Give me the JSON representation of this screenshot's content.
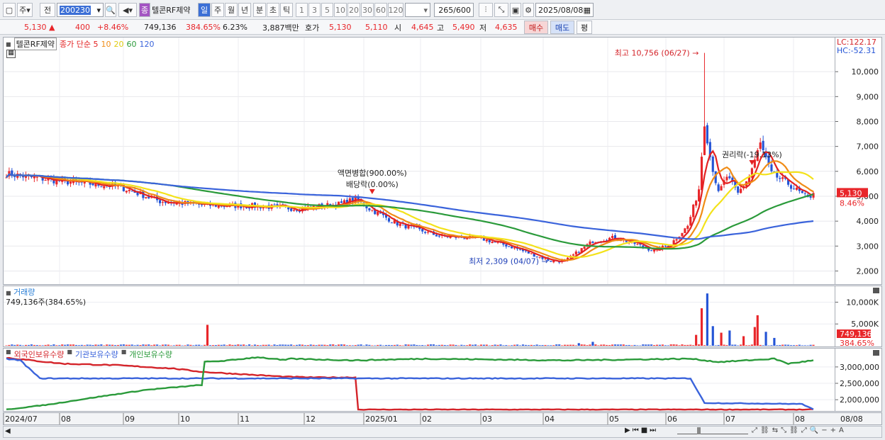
{
  "toolbar": {
    "code": "200230",
    "tab_ju": "주",
    "tab_jeon": "전",
    "badge": "종",
    "stock_name": "텔콘RF제약",
    "periods": [
      "일",
      "주",
      "월",
      "년",
      "분",
      "초",
      "틱"
    ],
    "intervals": [
      "1",
      "3",
      "5",
      "10",
      "20",
      "30",
      "60",
      "120"
    ],
    "count": "265",
    "count_total": "/600",
    "date": "2025/08/08"
  },
  "quote": {
    "price": "5,130",
    "arrow": "▲",
    "change": "400",
    "change_pct": "+8.46%",
    "volume": "749,136",
    "volume_pct": "384.65%",
    "turnover": "6.23%",
    "amount": "3,887백만",
    "hoga_label": "호가",
    "ask": "5,130",
    "bid": "5,110",
    "open_label": "시",
    "open": "4,645",
    "high_label": "고",
    "high": "5,490",
    "low_label": "저",
    "low": "4,635",
    "buy_btn": "매수",
    "sell_btn": "매도",
    "eval_btn": "평"
  },
  "colors": {
    "up": "#e8262a",
    "down": "#2454d6",
    "ma5": "#e32222",
    "ma10": "#f08c16",
    "ma20": "#f3e21a",
    "ma60": "#2a9a3a",
    "ma120": "#3a63db"
  },
  "chart_data": [
    {
      "type": "candlestick",
      "title": "텔콘RF제약",
      "legend": [
        "종가 단순 5",
        "10",
        "20",
        "60",
        "120"
      ],
      "ylim": [
        1700,
        11000
      ],
      "yticks": [
        "2,000",
        "3,000",
        "4,000",
        "5,000",
        "6,000",
        "7,000",
        "8,000",
        "9,000",
        "10,000"
      ],
      "ytick_values": [
        2000,
        3000,
        4000,
        5000,
        6000,
        7000,
        8000,
        9000,
        10000
      ],
      "x_labels": [
        "2024/07",
        "08",
        "09",
        "10",
        "11",
        "12",
        "2025/01",
        "02",
        "03",
        "04",
        "05",
        "06",
        "07",
        "08"
      ],
      "right_labels": {
        "lc": "LC:122.17",
        "hc": "HC:-52.31",
        "last": "5,130",
        "last_pct": "8.46%"
      },
      "annotations": {
        "high": "최고 10,756 (06/27)",
        "low": "최저 2,309 (04/07)",
        "event1": "액면병합(900.00%)",
        "event2": "배당락(0.00%)",
        "event3": "권리락(-19.13%)"
      },
      "high_value": 10756,
      "low_value": 2309,
      "close_approx_anchors": [
        [
          0,
          5900
        ],
        [
          20,
          5600
        ],
        [
          40,
          5400
        ],
        [
          55,
          4800
        ],
        [
          70,
          4650
        ],
        [
          90,
          4600
        ],
        [
          105,
          4500
        ],
        [
          120,
          4700
        ],
        [
          125,
          4900
        ],
        [
          130,
          4500
        ],
        [
          140,
          3900
        ],
        [
          155,
          3400
        ],
        [
          170,
          3300
        ],
        [
          180,
          3000
        ],
        [
          190,
          2600
        ],
        [
          195,
          2400
        ],
        [
          200,
          2400
        ],
        [
          205,
          2800
        ],
        [
          210,
          3200
        ],
        [
          218,
          3350
        ],
        [
          225,
          3100
        ],
        [
          232,
          2800
        ],
        [
          238,
          3100
        ],
        [
          244,
          3800
        ],
        [
          248,
          5300
        ],
        [
          250,
          8000
        ],
        [
          252,
          6600
        ],
        [
          255,
          5100
        ],
        [
          258,
          5800
        ],
        [
          262,
          5100
        ],
        [
          266,
          5800
        ],
        [
          270,
          7100
        ],
        [
          274,
          5900
        ],
        [
          280,
          5500
        ],
        [
          287,
          4900
        ],
        [
          289,
          5130
        ]
      ],
      "ma_series": [
        {
          "name": "5",
          "color": "#e32222"
        },
        {
          "name": "10",
          "color": "#f08c16"
        },
        {
          "name": "20",
          "color": "#f3e21a"
        },
        {
          "name": "60",
          "color": "#2a9a3a"
        },
        {
          "name": "120",
          "color": "#3a63db"
        }
      ]
    },
    {
      "type": "bar",
      "title": "거래량",
      "value_text": "749,136주(384.65%)",
      "yticks": [
        "5,000K",
        "10,000K"
      ],
      "ytick_values": [
        5000,
        10000
      ],
      "last_label": "749,136",
      "last_pct": "384.65%",
      "spikes": [
        [
          72,
          4800
        ],
        [
          205,
          600
        ],
        [
          210,
          900
        ],
        [
          247,
          2500
        ],
        [
          249,
          8600
        ],
        [
          251,
          12000
        ],
        [
          253,
          4500
        ],
        [
          256,
          3000
        ],
        [
          259,
          3500
        ],
        [
          264,
          2200
        ],
        [
          268,
          4300
        ],
        [
          269,
          7000
        ],
        [
          272,
          3200
        ],
        [
          275,
          1800
        ]
      ]
    },
    {
      "type": "line",
      "series": [
        {
          "name": "외국인보유수량",
          "color": "#d4242a"
        },
        {
          "name": "기관보유수량",
          "color": "#3a63db"
        },
        {
          "name": "개인보유수량",
          "color": "#2a9a3a"
        }
      ],
      "yticks": [
        "2,000,000",
        "2,500,000",
        "3,000,000"
      ],
      "ytick_values": [
        2000000,
        2500000,
        3000000
      ],
      "ylim": [
        1700000,
        3300000
      ],
      "foreign": [
        [
          0,
          3280000
        ],
        [
          20,
          3100000
        ],
        [
          40,
          3050000
        ],
        [
          60,
          2950000
        ],
        [
          70,
          2850000
        ],
        [
          80,
          2800000
        ],
        [
          90,
          2750000
        ],
        [
          100,
          2700000
        ],
        [
          110,
          2680000
        ],
        [
          125,
          2680000
        ],
        [
          126,
          1700000
        ],
        [
          289,
          1700000
        ]
      ],
      "institution": [
        [
          0,
          3250000
        ],
        [
          5,
          3200000
        ],
        [
          12,
          2650000
        ],
        [
          60,
          2650000
        ],
        [
          100,
          2650000
        ],
        [
          150,
          2650000
        ],
        [
          200,
          2650000
        ],
        [
          245,
          2650000
        ],
        [
          250,
          1900000
        ],
        [
          285,
          1870000
        ],
        [
          289,
          1700000
        ]
      ],
      "individual": [
        [
          0,
          1700000
        ],
        [
          15,
          1850000
        ],
        [
          30,
          2050000
        ],
        [
          50,
          2300000
        ],
        [
          70,
          2450000
        ],
        [
          71,
          3150000
        ],
        [
          80,
          3200000
        ],
        [
          90,
          3300000
        ],
        [
          100,
          3200000
        ],
        [
          101,
          3250000
        ],
        [
          125,
          3200000
        ],
        [
          150,
          3250000
        ],
        [
          200,
          3200000
        ],
        [
          245,
          3250000
        ],
        [
          255,
          3150000
        ],
        [
          265,
          3200000
        ],
        [
          275,
          3250000
        ],
        [
          280,
          3100000
        ],
        [
          289,
          3200000
        ]
      ]
    }
  ]
}
